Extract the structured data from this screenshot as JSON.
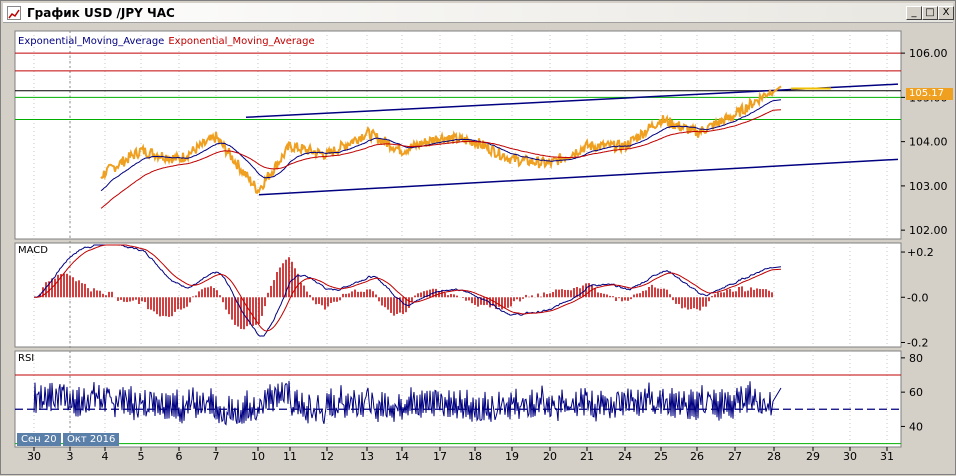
{
  "window": {
    "title": "График USD /JPY  ЧАС",
    "buttons": [
      "_",
      "□",
      "X"
    ]
  },
  "legend": {
    "ema1": "Exponential_Moving_Average",
    "ema2": "Exponential_Moving_Average"
  },
  "panels": {
    "macd_label": "MACD",
    "rsi_label": "RSI"
  },
  "current_price": "105.17",
  "date_labels": {
    "prev_month": "Сен 20",
    "cur_month": "Окт 2016"
  },
  "colors": {
    "background": "#ffffff",
    "price": "#f0a020",
    "ema_fast": "#000080",
    "ema_slow": "#c00000",
    "rsi_line": "#000080",
    "rsi_overbought": "#c000c0",
    "rsi_oversold": "#008000",
    "level_red": "#c00000",
    "level_green": "#00b000",
    "trend": "#000080"
  },
  "chart_data": [
    {
      "type": "line",
      "name": "price",
      "x": [
        "30",
        "3",
        "4",
        "5",
        "6",
        "7",
        "10",
        "11",
        "12",
        "13",
        "14",
        "17",
        "18",
        "19",
        "20",
        "21",
        "24",
        "25",
        "26",
        "27",
        "28"
      ],
      "series": [
        {
          "name": "",
          "values": [
            101.6,
            102.6,
            103.3,
            103.8,
            103.6,
            104.1,
            102.9,
            103.9,
            103.7,
            104.2,
            103.8,
            104.1,
            104.0,
            103.6,
            103.5,
            103.9,
            103.9,
            104.5,
            104.2,
            104.6,
            105.2
          ]
        }
      ],
      "price_ticks": [
        "106.00",
        "105.00",
        "104.00",
        "103.00",
        "102.00"
      ],
      "ylim": [
        101.8,
        106.5
      ],
      "levels_red": [
        106.0,
        105.6
      ],
      "levels_green": [
        105.0,
        104.5
      ],
      "level_black": 105.15,
      "trend_upper": [
        [
          104.5,
          104.9
        ],
        [
          105.4,
          105.1
        ]
      ],
      "xlabels": [
        "30",
        "3",
        "4",
        "5",
        "6",
        "7",
        "10",
        "11",
        "12",
        "13",
        "14",
        "17",
        "18",
        "19",
        "20",
        "21",
        "24",
        "25",
        "26",
        "27",
        "28",
        "29",
        "30",
        "31"
      ]
    },
    {
      "type": "bar",
      "name": "macd",
      "ticks": [
        "+0.2",
        "-0.0",
        "-0.2"
      ],
      "ylim": [
        -0.22,
        0.24
      ]
    },
    {
      "type": "line",
      "name": "rsi",
      "ticks": [
        "80",
        "60",
        "40"
      ],
      "ylim": [
        28,
        84
      ],
      "levels": [
        70,
        50,
        30
      ]
    }
  ]
}
